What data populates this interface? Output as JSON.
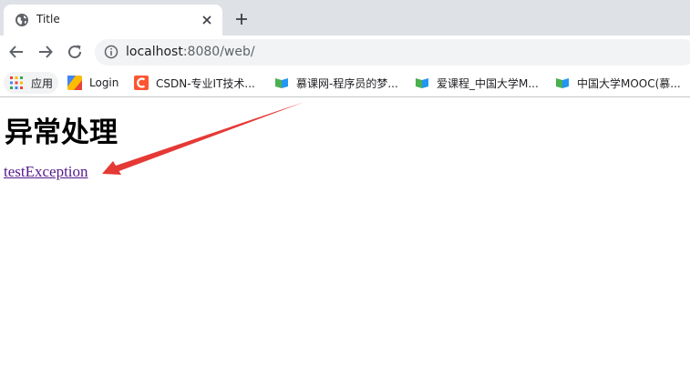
{
  "browser": {
    "tab": {
      "title": "Title"
    },
    "address": {
      "host": "localhost",
      "rest": ":8080/web/"
    },
    "bookmarks": [
      {
        "label": "应用",
        "icon": "apps-grid-icon"
      },
      {
        "label": "Login",
        "icon": "login-favicon-icon"
      },
      {
        "label": "CSDN-专业IT技术...",
        "icon": "csdn-favicon-icon"
      },
      {
        "label": "慕课网-程序员的梦...",
        "icon": "imooc-favicon-icon"
      },
      {
        "label": "爱课程_中国大学M...",
        "icon": "icourse-favicon-icon"
      },
      {
        "label": "中国大学MOOC(慕...",
        "icon": "mooc-favicon-icon"
      }
    ]
  },
  "page": {
    "heading": "异常处理",
    "link_text": "testException"
  },
  "annotation": {
    "icon": "red-arrow-icon",
    "color": "#e53935"
  },
  "colors": {
    "tabstrip": "#dee1e6",
    "omnibox": "#f1f3f4",
    "visited_link": "#551a8b"
  }
}
